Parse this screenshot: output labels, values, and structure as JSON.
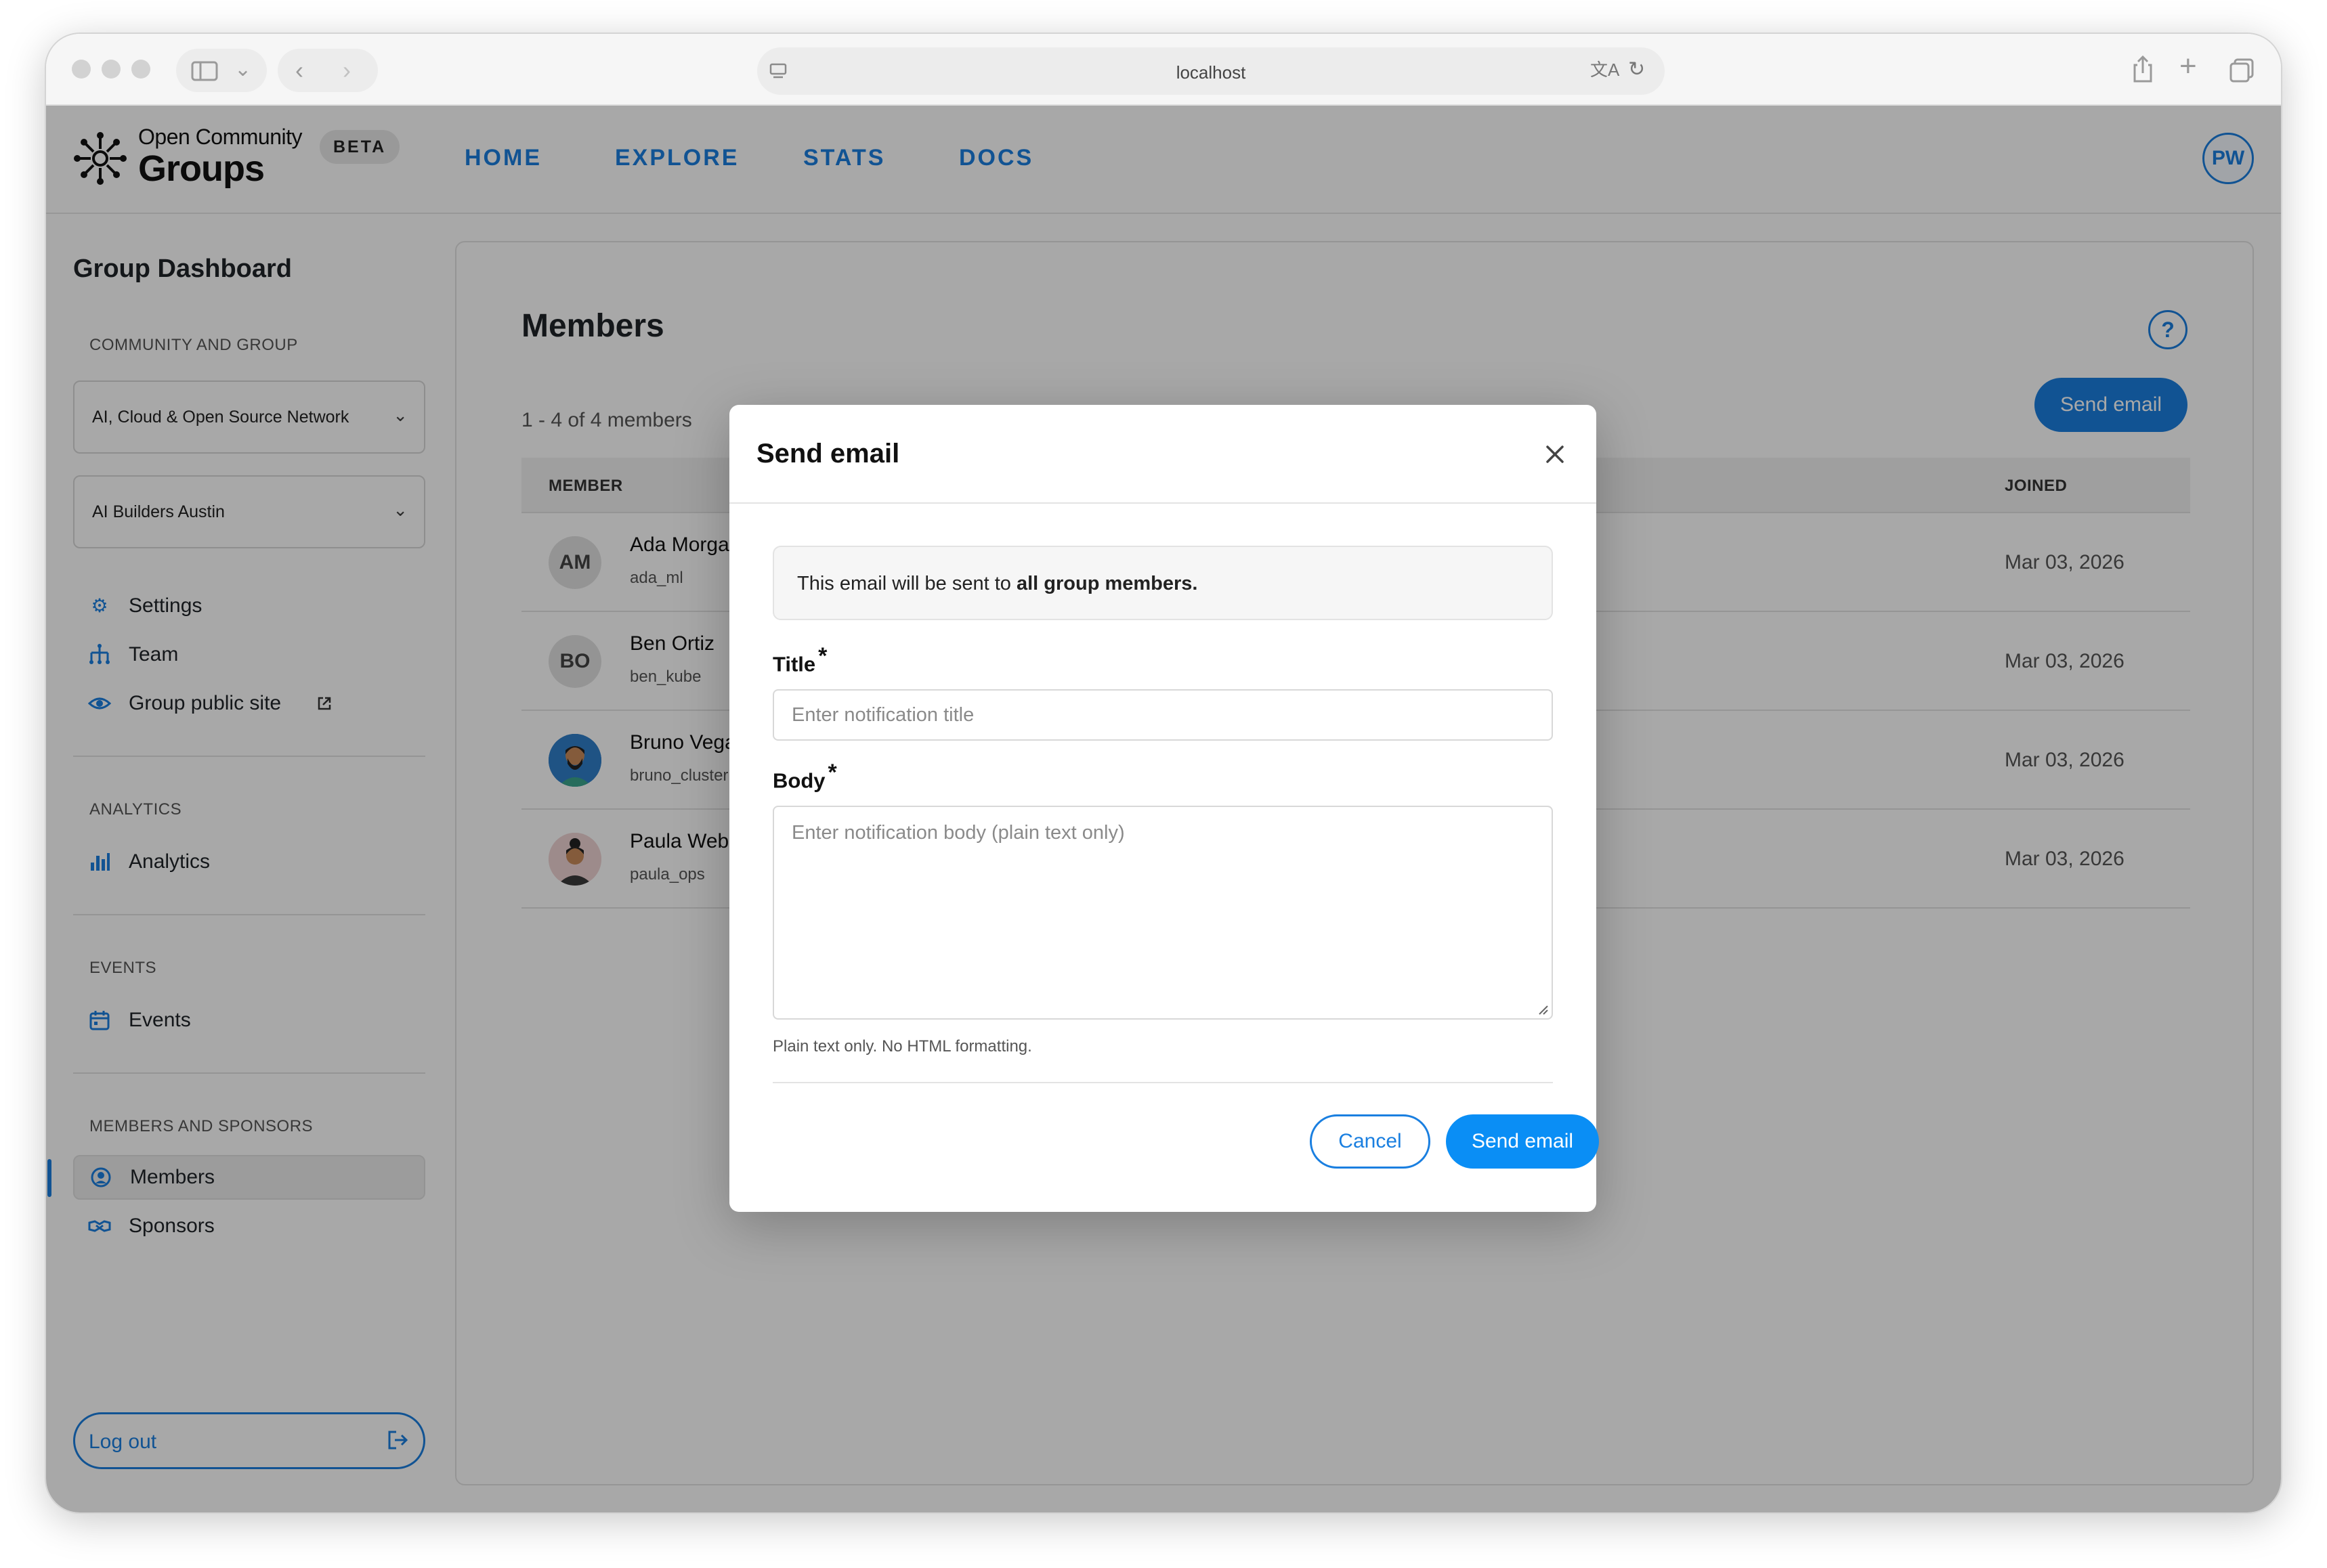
{
  "browser": {
    "url": "localhost"
  },
  "header": {
    "logo_line1": "Open Community",
    "logo_line2": "Groups",
    "beta": "BETA",
    "nav": [
      "HOME",
      "EXPLORE",
      "STATS",
      "DOCS"
    ],
    "user_initials": "PW"
  },
  "sidebar": {
    "title": "Group Dashboard",
    "section_community": "COMMUNITY AND GROUP",
    "community_select": "AI, Cloud & Open Source Network",
    "group_select": "AI Builders Austin",
    "settings": "Settings",
    "team": "Team",
    "public_site": "Group public site",
    "section_analytics": "ANALYTICS",
    "analytics": "Analytics",
    "section_events": "EVENTS",
    "events": "Events",
    "section_members": "MEMBERS AND SPONSORS",
    "members": "Members",
    "sponsors": "Sponsors",
    "logout": "Log out"
  },
  "main": {
    "title": "Members",
    "help": "?",
    "count": "1 - 4 of 4 members",
    "send_email": "Send email",
    "columns": {
      "member": "MEMBER",
      "joined": "JOINED"
    },
    "rows": [
      {
        "initials": "AM",
        "name": "Ada Morgan",
        "username": "ada_ml",
        "joined": "Mar 03, 2026"
      },
      {
        "initials": "BO",
        "name": "Ben Ortiz",
        "username": "ben_kube",
        "joined": "Mar 03, 2026"
      },
      {
        "initials": "",
        "name": "Bruno Vega",
        "username": "bruno_cluster",
        "joined": "Mar 03, 2026"
      },
      {
        "initials": "",
        "name": "Paula Webb",
        "username": "paula_ops",
        "joined": "Mar 03, 2026"
      }
    ]
  },
  "modal": {
    "title": "Send email",
    "info_prefix": "This email will be sent to ",
    "info_bold": "all group members.",
    "title_label": "Title",
    "title_placeholder": "Enter notification title",
    "body_label": "Body",
    "body_placeholder": "Enter notification body (plain text only)",
    "required_mark": "*",
    "help": "Plain text only. No HTML formatting.",
    "cancel": "Cancel",
    "send": "Send email"
  },
  "colors": {
    "accent": "#1a7fe0",
    "primary_button": "#0a8ef5",
    "overlay": "rgba(0,0,0,0.34)"
  }
}
